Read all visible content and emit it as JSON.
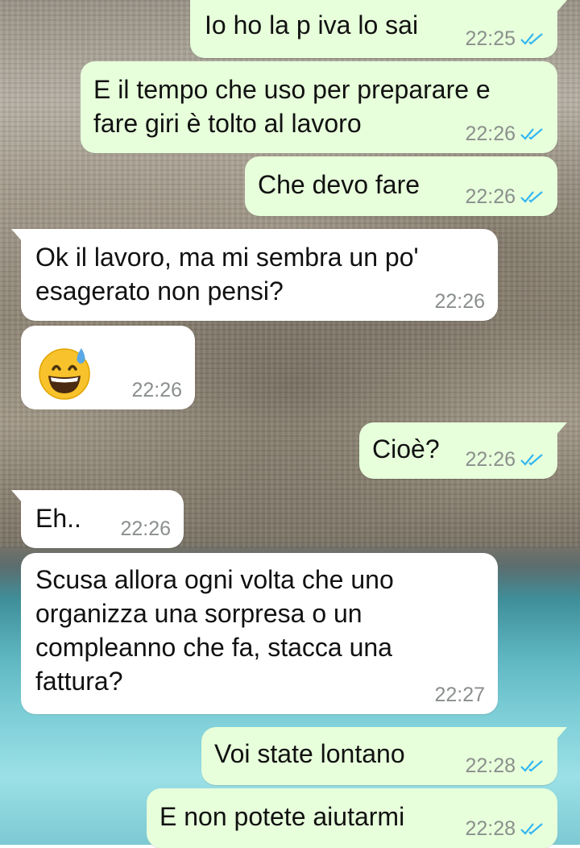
{
  "colors": {
    "outgoing_bubble": "#e7ffdb",
    "incoming_bubble": "#ffffff",
    "read_ticks": "#34b7f1",
    "timestamp": "#8a8f8c"
  },
  "messages": [
    {
      "direction": "out",
      "text": "Io ho la p iva lo sai",
      "time": "22:25",
      "status": "read"
    },
    {
      "direction": "out",
      "text": "E il tempo che uso per preparare e\nfare giri è tolto al lavoro",
      "time": "22:26",
      "status": "read"
    },
    {
      "direction": "out",
      "text": "Che devo fare",
      "time": "22:26",
      "status": "read"
    },
    {
      "direction": "in",
      "text": "Ok il lavoro, ma mi sembra un po'\nesagerato non pensi?",
      "time": "22:26"
    },
    {
      "direction": "in",
      "emoji": "grinning-face-with-sweat",
      "time": "22:26"
    },
    {
      "direction": "out",
      "text": "Cioè?",
      "time": "22:26",
      "status": "read"
    },
    {
      "direction": "in",
      "text": "Eh..",
      "time": "22:26"
    },
    {
      "direction": "in",
      "text": "Scusa allora ogni volta che uno\norganizza una sorpresa o un\ncompleanno che fa, stacca una\nfattura?",
      "time": "22:27"
    },
    {
      "direction": "out",
      "text": "Voi state lontano",
      "time": "22:28",
      "status": "read"
    },
    {
      "direction": "out",
      "text": "E non potete aiutarmi",
      "time": "22:28",
      "status": "read"
    }
  ]
}
